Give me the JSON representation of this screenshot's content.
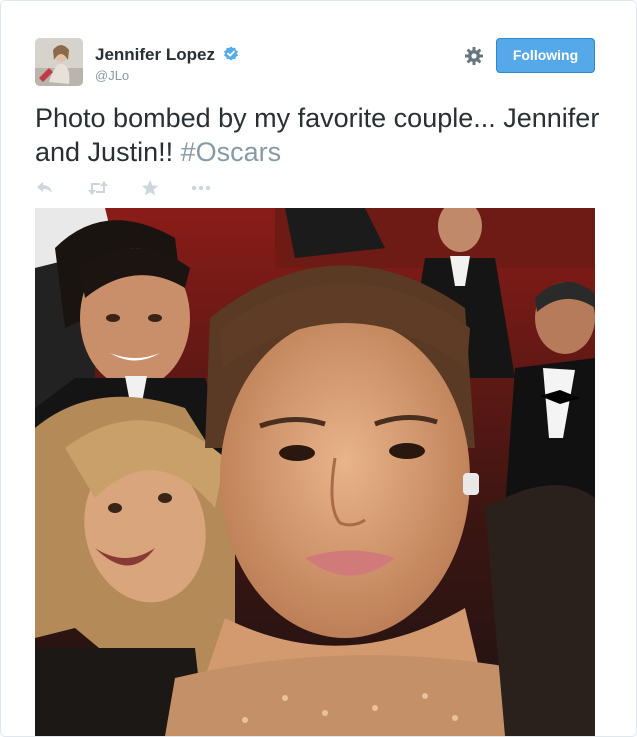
{
  "tweet": {
    "author_name": "Jennifer Lopez",
    "author_handle": "@JLo",
    "verified": true,
    "follow_button_label": "Following",
    "text_main": "Photo bombed by my favorite couple... Jennifer and Justin!! ",
    "hashtag": "#Oscars",
    "actions": [
      "reply-icon",
      "retweet-icon",
      "favorite-icon",
      "more-icon"
    ]
  },
  "colors": {
    "name_text": "#292f33",
    "meta_text": "#8899a6",
    "button_blue": "#56a9e9",
    "verified_blue": "#55acee"
  }
}
